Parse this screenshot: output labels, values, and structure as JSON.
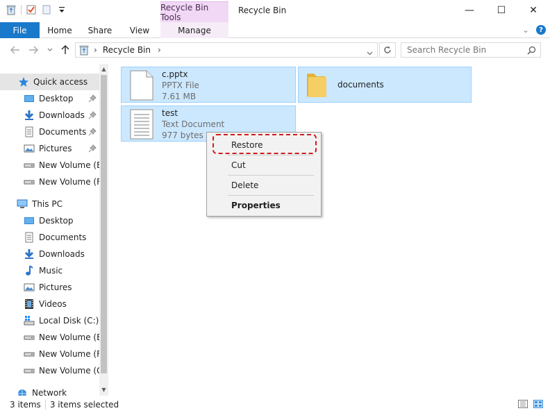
{
  "window": {
    "title": "Recycle Bin",
    "tools_tab": "Recycle Bin Tools",
    "minimize_glyph": "—",
    "maximize_glyph": "☐",
    "close_glyph": "✕"
  },
  "ribbon": {
    "tabs": [
      "File",
      "Home",
      "Share",
      "View",
      "Manage"
    ],
    "help_glyph": "?",
    "expand_glyph": "⌄"
  },
  "address": {
    "path": "Recycle Bin",
    "separator": "›",
    "search_placeholder": "Search Recycle Bin"
  },
  "nav": {
    "quick_access": "Quick access",
    "quick_items": [
      "Desktop",
      "Downloads",
      "Documents",
      "Pictures",
      "New Volume (E:)",
      "New Volume (F:)"
    ],
    "this_pc": "This PC",
    "pc_items": [
      "Desktop",
      "Documents",
      "Downloads",
      "Music",
      "Pictures",
      "Videos",
      "Local Disk (C:)",
      "New Volume (E:)",
      "New Volume (F:)",
      "New Volume (G:)"
    ],
    "network": "Network"
  },
  "files": [
    {
      "name": "c.pptx",
      "type": "PPTX File",
      "size": "7.61 MB"
    },
    {
      "name": "documents"
    },
    {
      "name": "test",
      "type": "Text Document",
      "size": "977 bytes"
    }
  ],
  "context_menu": {
    "restore": "Restore",
    "cut": "Cut",
    "delete": "Delete",
    "properties": "Properties"
  },
  "status": {
    "count": "3 items",
    "selected": "3 items selected"
  },
  "colors": {
    "accent": "#1979ca",
    "selection": "#cce8ff",
    "highlight": "#d11a1a",
    "tools_tab": "#f1d8f4"
  }
}
